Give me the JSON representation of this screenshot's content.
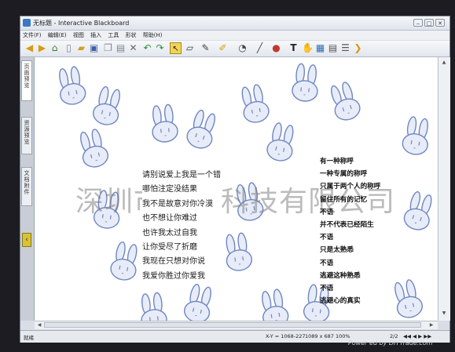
{
  "window": {
    "title": "无标题 - Interactive Blackboard"
  },
  "menu": [
    "文件(F)",
    "编辑(E)",
    "视图",
    "插入",
    "工具",
    "形状",
    "帮助(H)"
  ],
  "sidebar": {
    "tabs": [
      "页面预览",
      "资源预览",
      "文档附件"
    ],
    "collapse_glyph": "‹"
  },
  "poem_left": [
    "请别说爱上我是一个错",
    "哪怕注定没结果",
    "我不是故意对你冷漠",
    "也不想让你难过",
    "也许我太过自我",
    "让你受尽了折磨",
    "我现在只想对你说",
    "我爱你胜过你爱我"
  ],
  "poem_right": [
    "有一种称呼",
    "一种专属的称呼",
    "只属于两个人的称呼",
    "留住所有的记忆",
    "不语",
    "并不代表已经陌生",
    "不语",
    "只是太熟悉",
    "不语",
    "逃避这种熟悉",
    "不语",
    "逃避心的真实"
  ],
  "watermark": "深圳市新涛科技有限公司",
  "status": {
    "ready": "就绪",
    "coords": "X-Y = 1068-227",
    "size": "1089 x 687 100%",
    "page": "2/2",
    "nav": "◀◀ ◀ ▶ ▶▶"
  },
  "credit": "Power ed by DIYTrade.com",
  "colors": {
    "bunny_fill": "#e7ecf8",
    "bunny_stroke": "#6f86c4",
    "selected_tool": "#f2d25a"
  },
  "icons": [
    "back-arrow-icon",
    "forward-arrow-icon",
    "home-icon",
    "new-page-icon",
    "open-folder-icon",
    "save-icon",
    "copy-icon",
    "paste-icon",
    "delete-icon",
    "undo-icon",
    "redo-icon",
    "select-cursor-icon",
    "eraser-icon",
    "pen-icon",
    "highlighter-icon",
    "fill-icon",
    "line-icon",
    "color-icon",
    "text-icon",
    "hand-icon",
    "image-icon",
    "table-icon",
    "layers-icon",
    "next-icon"
  ]
}
